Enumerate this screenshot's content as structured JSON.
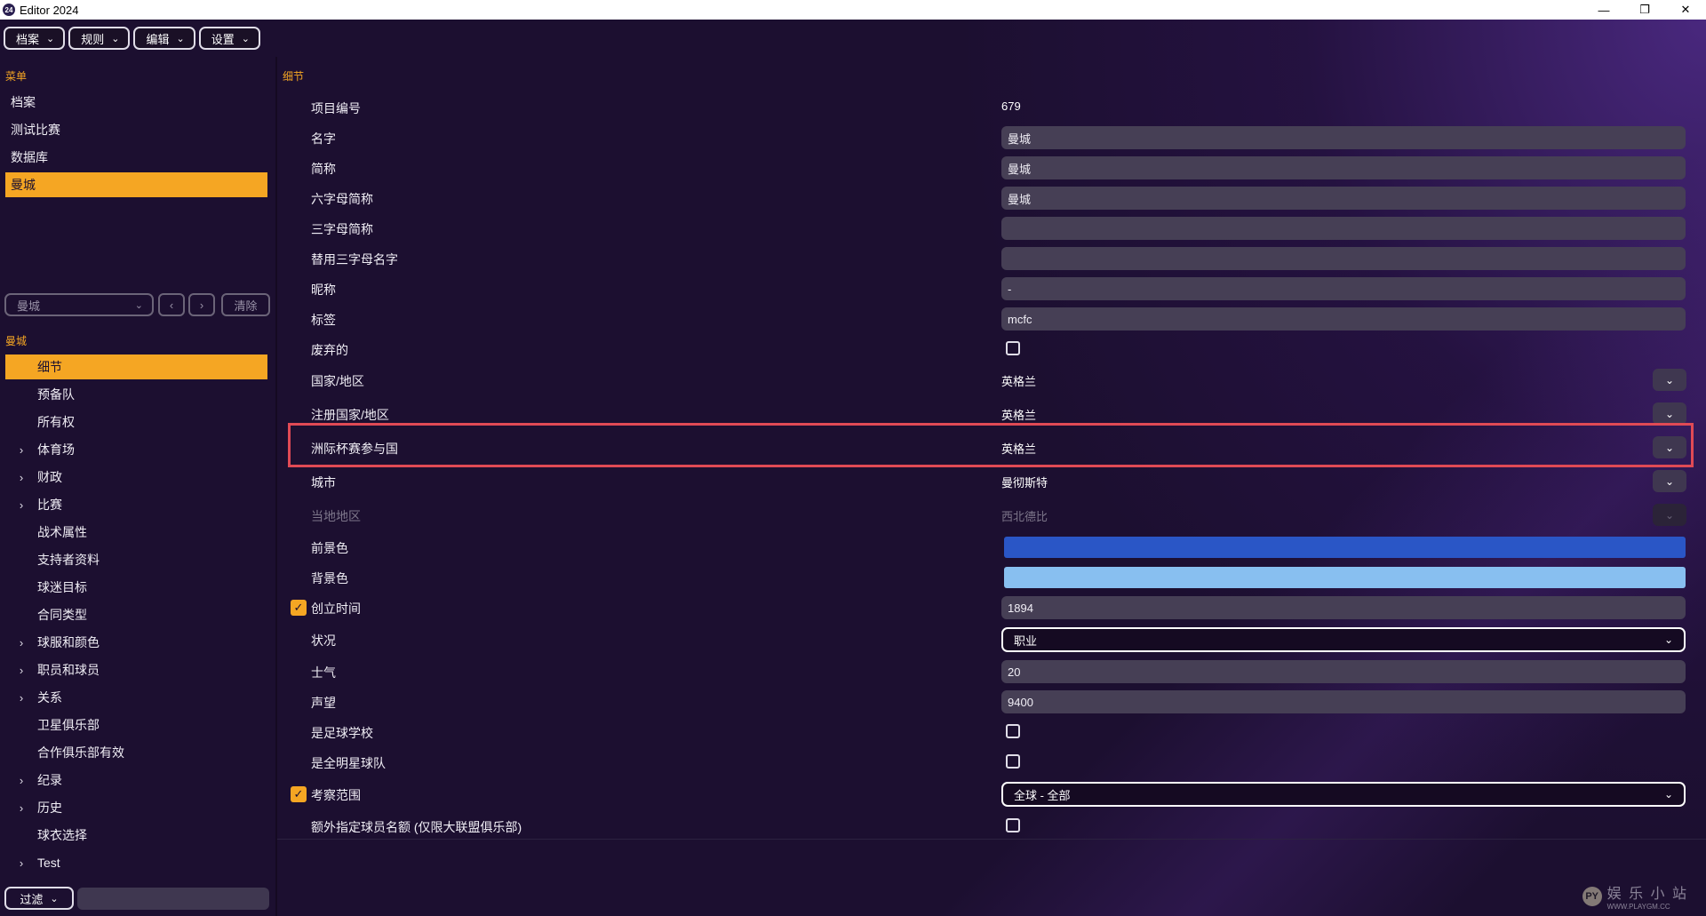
{
  "window": {
    "title": "Editor 2024",
    "app_icon": "24",
    "minimize_glyph": "—",
    "restore_glyph": "❐",
    "close_glyph": "✕"
  },
  "menubar": [
    {
      "label": "档案"
    },
    {
      "label": "规则"
    },
    {
      "label": "编辑"
    },
    {
      "label": "设置"
    }
  ],
  "sidebar": {
    "menu_label": "菜单",
    "menu_items": [
      {
        "label": "档案"
      },
      {
        "label": "测试比赛"
      },
      {
        "label": "数据库"
      },
      {
        "label": "曼城",
        "active": true
      }
    ],
    "selector": {
      "value": "曼城",
      "prev": "‹",
      "next": "›",
      "clear_label": "清除"
    },
    "tree_label": "曼城",
    "tree": [
      {
        "label": "细节",
        "expandable": false,
        "active": true
      },
      {
        "label": "预备队",
        "expandable": false
      },
      {
        "label": "所有权",
        "expandable": false
      },
      {
        "label": "体育场",
        "expandable": true
      },
      {
        "label": "财政",
        "expandable": true
      },
      {
        "label": "比赛",
        "expandable": true
      },
      {
        "label": "战术属性",
        "expandable": false
      },
      {
        "label": "支持者资料",
        "expandable": false
      },
      {
        "label": "球迷目标",
        "expandable": false
      },
      {
        "label": "合同类型",
        "expandable": false
      },
      {
        "label": "球服和颜色",
        "expandable": true
      },
      {
        "label": "职员和球员",
        "expandable": true
      },
      {
        "label": "关系",
        "expandable": true
      },
      {
        "label": "卫星俱乐部",
        "expandable": false
      },
      {
        "label": "合作俱乐部有效",
        "expandable": false
      },
      {
        "label": "纪录",
        "expandable": true
      },
      {
        "label": "历史",
        "expandable": true
      },
      {
        "label": "球衣选择",
        "expandable": false
      },
      {
        "label": "Test",
        "expandable": true
      }
    ],
    "filter_label": "过滤",
    "filter_value": ""
  },
  "details": {
    "section_label": "细节",
    "rows": [
      {
        "label": "项目编号",
        "type": "text",
        "value": "679"
      },
      {
        "label": "名字",
        "type": "input",
        "value": "曼城"
      },
      {
        "label": "简称",
        "type": "input",
        "value": "曼城"
      },
      {
        "label": "六字母简称",
        "type": "input",
        "value": "曼城"
      },
      {
        "label": "三字母简称",
        "type": "input",
        "value": ""
      },
      {
        "label": "替用三字母名字",
        "type": "input",
        "value": ""
      },
      {
        "label": "昵称",
        "type": "input",
        "value": "-"
      },
      {
        "label": "标签",
        "type": "input",
        "value": "mcfc"
      },
      {
        "label": "废弃的",
        "type": "checkbox",
        "checked": false
      },
      {
        "label": "国家/地区",
        "type": "select",
        "value": "英格兰"
      },
      {
        "label": "注册国家/地区",
        "type": "select",
        "value": "英格兰"
      },
      {
        "label": "洲际杯赛参与国",
        "type": "select",
        "value": "英格兰",
        "highlighted": true
      },
      {
        "label": "城市",
        "type": "select",
        "value": "曼彻斯特"
      },
      {
        "label": "当地地区",
        "type": "select",
        "value": "西北德比",
        "disabled": true
      },
      {
        "label": "前景色",
        "type": "color",
        "color": "#2a56c6"
      },
      {
        "label": "背景色",
        "type": "color",
        "color": "#88bff0"
      },
      {
        "label": "创立时间",
        "type": "input",
        "value": "1894",
        "prefix_checked": true
      },
      {
        "label": "状况",
        "type": "dropdown",
        "value": "职业"
      },
      {
        "label": "士气",
        "type": "input",
        "value": "20"
      },
      {
        "label": "声望",
        "type": "input",
        "value": "9400"
      },
      {
        "label": "是足球学校",
        "type": "checkbox",
        "checked": false
      },
      {
        "label": "是全明星球队",
        "type": "checkbox",
        "checked": false
      },
      {
        "label": "考察范围",
        "type": "dropdown",
        "value": "全球 - 全部",
        "prefix_checked": true
      },
      {
        "label": "额外指定球员名额 (仅限大联盟俱乐部)",
        "type": "checkbox",
        "checked": false
      }
    ]
  },
  "watermark": {
    "logo": "PY",
    "title": "娱 乐 小 站",
    "url": "WWW.PLAYGM.CC"
  },
  "icons": {
    "chevron": "chevron-down-icon",
    "arrow": "chevron-right-icon",
    "check": "check-icon"
  },
  "colors": {
    "accent": "#f5a623",
    "highlight_border": "#e04a55",
    "background": "#1c0f30"
  }
}
